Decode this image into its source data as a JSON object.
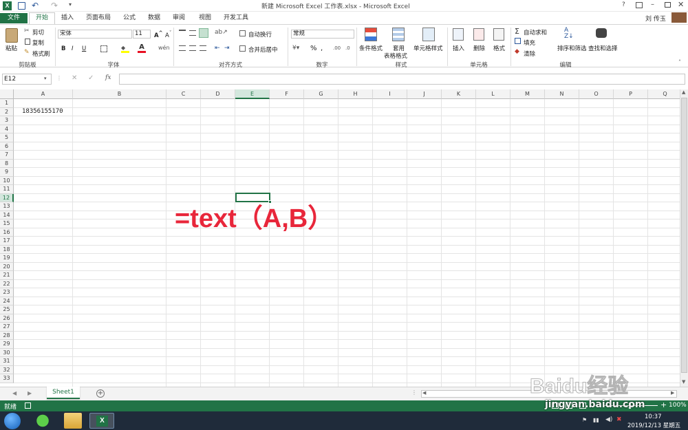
{
  "window": {
    "title": "新建 Microsoft Excel 工作表.xlsx - Microsoft Excel",
    "user": "刘 传玉"
  },
  "tabs": [
    {
      "label": "文件"
    },
    {
      "label": "开始"
    },
    {
      "label": "插入"
    },
    {
      "label": "页面布局"
    },
    {
      "label": "公式"
    },
    {
      "label": "数据"
    },
    {
      "label": "审阅"
    },
    {
      "label": "视图"
    },
    {
      "label": "开发工具"
    }
  ],
  "ribbon": {
    "clipboard": {
      "paste": "粘贴",
      "cut": "剪切",
      "copy": "复制",
      "painter": "格式刷",
      "label": "剪贴板"
    },
    "font": {
      "name": "宋体",
      "size": "11",
      "label": "字体",
      "bold": "B",
      "italic": "I",
      "underline": "U"
    },
    "align": {
      "wrap": "自动换行",
      "merge": "合并后居中",
      "label": "对齐方式"
    },
    "number": {
      "format": "常规",
      "label": "数字"
    },
    "styles": {
      "cond": "条件格式",
      "table1": "套用",
      "table2": "表格格式",
      "cell": "单元格样式",
      "label": "样式"
    },
    "cells": {
      "insert": "插入",
      "delete": "删除",
      "format": "格式",
      "label": "单元格"
    },
    "edit": {
      "autosum": "自动求和",
      "fill": "填充",
      "clear": "清除",
      "sort": "排序和筛选",
      "find": "查找和选择",
      "label": "编辑"
    }
  },
  "formula_bar": {
    "name_box": "E12",
    "fx": "fx",
    "content": ""
  },
  "grid": {
    "columns": [
      "A",
      "B",
      "C",
      "D",
      "E",
      "F",
      "G",
      "H",
      "I",
      "J",
      "K",
      "L",
      "M",
      "N",
      "O",
      "P",
      "Q"
    ],
    "rows": [
      "1",
      "2",
      "3",
      "4",
      "5",
      "6",
      "7",
      "8",
      "9",
      "10",
      "11",
      "12",
      "13",
      "14",
      "15",
      "16",
      "17",
      "18",
      "19",
      "20",
      "21",
      "22",
      "23",
      "24",
      "25",
      "26",
      "27",
      "28",
      "29",
      "30",
      "31",
      "32",
      "33"
    ],
    "cell_A2": "18356155170",
    "selected": "E12",
    "overlay_text": "=text（A,B）",
    "overlay_color": "#e8263a"
  },
  "sheets": [
    "Sheet1"
  ],
  "status": {
    "ready": "就绪",
    "zoom": "100%"
  },
  "taskbar": {
    "time": "10:37",
    "date": "2019/12/13 星期五"
  },
  "watermark": {
    "line1": "Baidu经验",
    "line2": "jingyan.baidu.com"
  },
  "colors": {
    "excel_green": "#217346",
    "accent_red": "#e8263a"
  }
}
